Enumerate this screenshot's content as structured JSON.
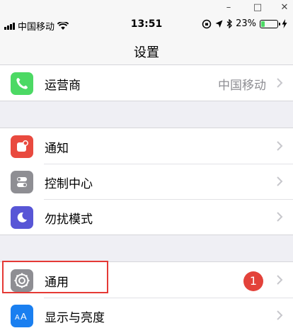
{
  "window": {
    "minimize": "–",
    "maximize": "□",
    "close": "✕"
  },
  "status": {
    "carrier": "中国移动",
    "time": "13:51",
    "battery_pct": "23%",
    "battery_level": 0.23
  },
  "nav": {
    "title": "设置"
  },
  "group1": [
    {
      "label": "运营商",
      "value": "中国移动",
      "icon": "phone-icon",
      "color": "#4cd964"
    }
  ],
  "group2": [
    {
      "label": "通知",
      "icon": "notifications-icon",
      "color": "#e94a3f"
    },
    {
      "label": "控制中心",
      "icon": "control-center-icon",
      "color": "#8e8e93"
    },
    {
      "label": "勿扰模式",
      "icon": "moon-icon",
      "color": "#5856d6"
    }
  ],
  "group3": [
    {
      "label": "通用",
      "badge": "1",
      "icon": "gear-icon",
      "color": "#8e8e93"
    },
    {
      "label": "显示与亮度",
      "icon": "display-brightness-icon",
      "color": "#1a7ff0"
    }
  ]
}
